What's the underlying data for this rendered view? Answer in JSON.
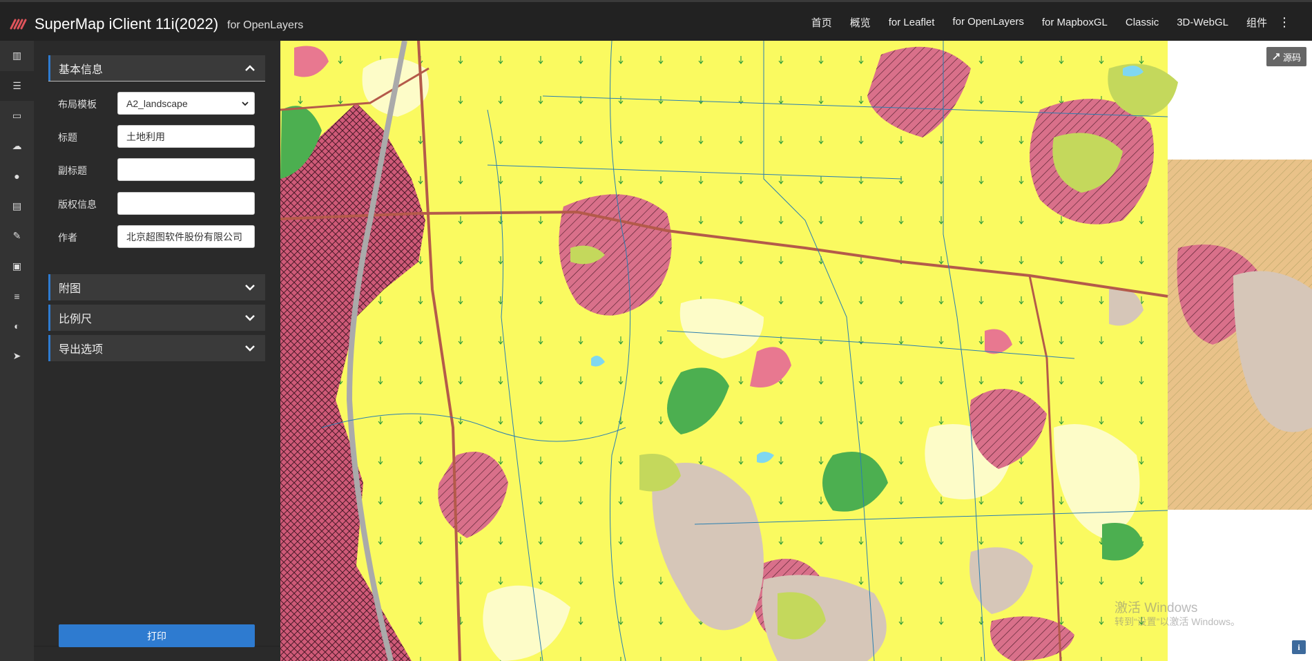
{
  "app": {
    "title": "SuperMap iClient 11i(2022)",
    "subtitle": "for OpenLayers"
  },
  "nav": {
    "items": [
      {
        "label": "首页",
        "active": false
      },
      {
        "label": "概览",
        "active": false
      },
      {
        "label": "for Leaflet",
        "active": false
      },
      {
        "label": "for OpenLayers",
        "active": true
      },
      {
        "label": "for MapboxGL",
        "active": false
      },
      {
        "label": "Classic",
        "active": false
      },
      {
        "label": "3D-WebGL",
        "active": false
      },
      {
        "label": "组件",
        "active": false
      }
    ],
    "more": "⋮"
  },
  "sidebar_icons": [
    {
      "name": "columns-icon",
      "glyph": "▥"
    },
    {
      "name": "layers-icon",
      "glyph": "☰"
    },
    {
      "name": "monitor-icon",
      "glyph": "▭"
    },
    {
      "name": "cloud-icon",
      "glyph": "☁"
    },
    {
      "name": "users-icon",
      "glyph": "●"
    },
    {
      "name": "map-icon",
      "glyph": "▤"
    },
    {
      "name": "edit-icon",
      "glyph": "✎"
    },
    {
      "name": "crop-icon",
      "glyph": "▣"
    },
    {
      "name": "sliders-icon",
      "glyph": "≡"
    },
    {
      "name": "globe-icon",
      "glyph": "◐"
    },
    {
      "name": "send-icon",
      "glyph": "➤"
    }
  ],
  "panel": {
    "basic_info": {
      "title": "基本信息",
      "fields": {
        "layout_template": {
          "label": "布局模板",
          "value": "A2_landscape"
        },
        "title": {
          "label": "标题",
          "value": "土地利用"
        },
        "subtitle": {
          "label": "副标题",
          "value": ""
        },
        "copyright": {
          "label": "版权信息",
          "value": ""
        },
        "author": {
          "label": "作者",
          "value": "北京超图软件股份有限公司"
        }
      }
    },
    "sections": [
      {
        "title": "附图"
      },
      {
        "title": "比例尺"
      },
      {
        "title": "导出选项"
      }
    ],
    "print_label": "打印"
  },
  "map": {
    "source_label": "源码",
    "info_label": "i",
    "watermark_line1": "激活 Windows",
    "watermark_line2": "转到“设置”以激活 Windows。"
  }
}
